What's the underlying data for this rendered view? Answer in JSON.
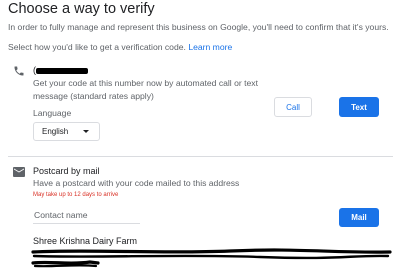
{
  "header": {
    "title": "Choose a way to verify",
    "intro": "In order to fully manage and represent this business on Google, you'll need to confirm that it's yours.",
    "select_prefix": "Select how you'd like to get a verification code. ",
    "learn_more": "Learn more"
  },
  "phone_option": {
    "number_prefix": "(",
    "icon": "phone-icon",
    "description": "Get your code at this number now by automated call or text message (standard rates apply)",
    "language_label": "Language",
    "language_value": "English",
    "call_label": "Call",
    "text_label": "Text"
  },
  "mail_option": {
    "icon": "mail-icon",
    "title": "Postcard by mail",
    "description": "Have a postcard with your code mailed to this address",
    "warning": "May take up to 12 days to arrive",
    "contact_placeholder": "Contact name",
    "mail_label": "Mail",
    "business_name": "Shree Krishna Dairy Farm"
  },
  "colors": {
    "accent": "#1a73e8",
    "warning": "#d93025",
    "secondary_text": "#5f6368",
    "border": "#dadce0"
  }
}
